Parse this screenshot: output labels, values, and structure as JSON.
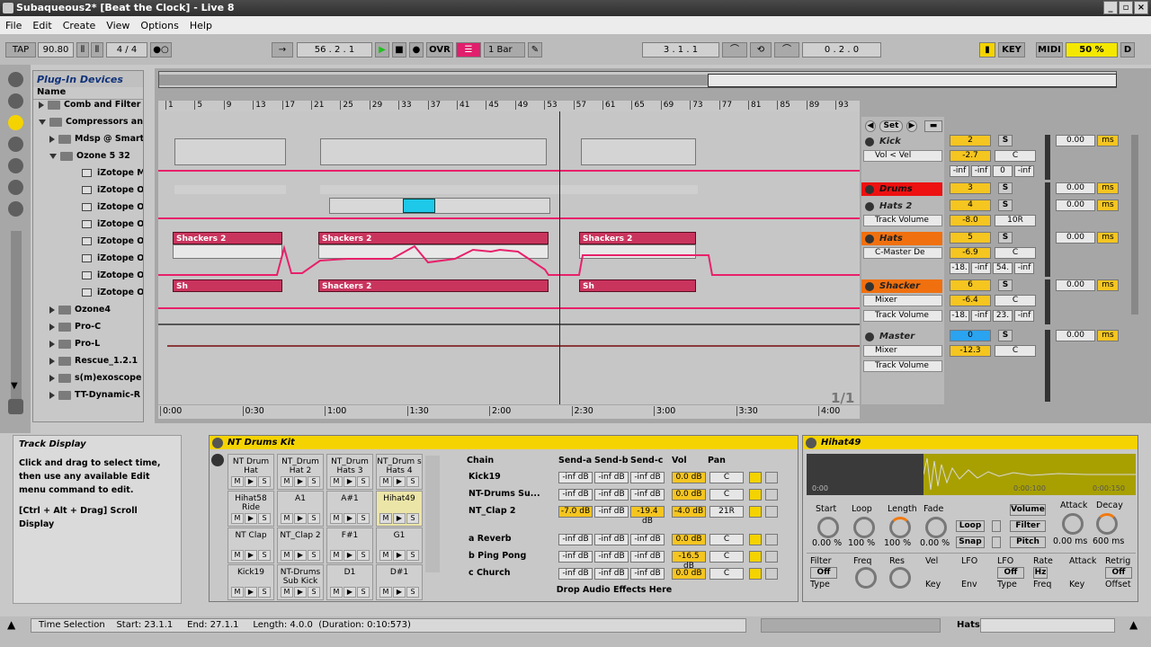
{
  "title_bar": {
    "title": "Subaqueous2*  [Beat the Clock] - Live 8"
  },
  "menu": [
    "File",
    "Edit",
    "Create",
    "View",
    "Options",
    "Help"
  ],
  "transport": {
    "tap": "TAP",
    "tempo": "90.80",
    "signature": "4 / 4",
    "position": "56 . 2 . 1",
    "ovr": "OVR",
    "quantize": "1 Bar",
    "loop_start": "3 . 1 . 1",
    "loop_length": "0 . 2 . 0",
    "key": "KEY",
    "midi": "MIDI",
    "cpu": "50 %",
    "d": "D"
  },
  "browser": {
    "title": "Plug-In Devices",
    "column": "Name",
    "items": [
      {
        "label": "Comb and Filter",
        "type": "folder",
        "level": 1,
        "open": false
      },
      {
        "label": "Compressors and",
        "type": "folder",
        "level": 1,
        "open": true
      },
      {
        "label": "Mdsp @ Smart",
        "type": "folder",
        "level": 2,
        "open": false
      },
      {
        "label": "Ozone 5 32",
        "type": "folder",
        "level": 2,
        "open": true
      },
      {
        "label": "iZotope Me",
        "type": "plugin",
        "level": 3
      },
      {
        "label": "iZotope Oz",
        "type": "plugin",
        "level": 3
      },
      {
        "label": "iZotope Oz",
        "type": "plugin",
        "level": 3
      },
      {
        "label": "iZotope Oz",
        "type": "plugin",
        "level": 3
      },
      {
        "label": "iZotope Oz",
        "type": "plugin",
        "level": 3
      },
      {
        "label": "iZotope Oz",
        "type": "plugin",
        "level": 3
      },
      {
        "label": "iZotope Oz",
        "type": "plugin",
        "level": 3
      },
      {
        "label": "iZotope Oz",
        "type": "plugin",
        "level": 3
      },
      {
        "label": "Ozone4",
        "type": "folder",
        "level": 2,
        "open": false
      },
      {
        "label": "Pro-C",
        "type": "folder",
        "level": 2,
        "open": false
      },
      {
        "label": "Pro-L",
        "type": "folder",
        "level": 2,
        "open": false
      },
      {
        "label": "Rescue_1.2.1",
        "type": "folder",
        "level": 2,
        "open": false
      },
      {
        "label": "s(m)exoscope",
        "type": "folder",
        "level": 2,
        "open": false
      },
      {
        "label": "TT-Dynamic-R",
        "type": "folder",
        "level": 2,
        "open": false
      }
    ]
  },
  "ruler": {
    "bars": [
      "1",
      "5",
      "9",
      "13",
      "17",
      "21",
      "25",
      "29",
      "33",
      "37",
      "41",
      "45",
      "49",
      "53",
      "57",
      "61",
      "65",
      "69",
      "73",
      "77",
      "81",
      "85",
      "89",
      "93"
    ]
  },
  "time_axis": [
    "0:00",
    "0:30",
    "1:00",
    "1:30",
    "2:00",
    "2:30",
    "3:00",
    "3:30",
    "4:00"
  ],
  "clips": {
    "shackers": "Shackers 2",
    "sh": "Sh",
    "page": "1/1"
  },
  "set_button": "Set",
  "tracks": [
    {
      "name": "Kick",
      "device": "Vol < Vel",
      "num": "2",
      "vol": "-2.7",
      "pan": "C",
      "sends": [
        "-inf",
        "-inf",
        "0",
        "-inf"
      ],
      "sendval": "0.00",
      "unit": "ms"
    },
    {
      "name": "Drums",
      "device": "",
      "num": "3",
      "vol": "",
      "pan": "",
      "sendval": "0.00",
      "unit": "ms"
    },
    {
      "name": "Hats 2",
      "device": "Track Volume",
      "num": "4",
      "vol": "-8.0",
      "pan": "10R",
      "sendval": "0.00",
      "unit": "ms"
    },
    {
      "name": "Hats",
      "device": "C-Master De",
      "device2": "",
      "num": "5",
      "vol": "-6.9",
      "pan": "C",
      "sends": [
        "-18.",
        "-inf",
        "54.",
        "-inf"
      ],
      "sendval": "0.00",
      "unit": "ms"
    },
    {
      "name": "Shacker",
      "device": "Mixer",
      "device2": "Track Volume",
      "num": "6",
      "vol": "-6.4",
      "pan": "C",
      "sends": [
        "-18.",
        "-inf",
        "23.",
        "-inf"
      ],
      "sendval": "0.00",
      "unit": "ms"
    },
    {
      "name": "Master",
      "device": "Mixer",
      "device2": "Track Volume",
      "num": "0",
      "vol": "-12.3",
      "pan": "C",
      "sendval": "0.00",
      "unit": "ms"
    }
  ],
  "info": {
    "title": "Track Display",
    "text1": "Click and drag to select time, then use any available Edit menu command to edit.",
    "text2": "[Ctrl + Alt + Drag] Scroll Display"
  },
  "drum_rack": {
    "title": "NT Drums Kit",
    "pads": [
      [
        "NT Drum Hat",
        "NT_Drum Hat 2",
        "NT_Drum Hats 3",
        "NT_Drum s Hats 4"
      ],
      [
        "Hihat58 Ride",
        "A1",
        "A#1",
        "Hihat49"
      ],
      [
        "NT Clap",
        "NT_Clap 2",
        "F#1",
        "G1"
      ],
      [
        "Kick19",
        "NT-Drums Sub Kick",
        "D1",
        "D#1"
      ]
    ],
    "mute": "M",
    "play": "▶",
    "solo": "S",
    "chain_headers": [
      "Chain",
      "Send-a",
      "Send-b",
      "Send-c",
      "Vol",
      "Pan"
    ],
    "chains": [
      {
        "name": "Kick19",
        "a": "-inf dB",
        "b": "-inf dB",
        "c": "-inf dB",
        "vol": "0.0 dB",
        "pan": "C"
      },
      {
        "name": "NT-Drums Su...",
        "a": "-inf dB",
        "b": "-inf dB",
        "c": "-inf dB",
        "vol": "0.0 dB",
        "pan": "C"
      },
      {
        "name": "NT_Clap 2",
        "a": "-7.0 dB",
        "b": "-inf dB",
        "c": "-19.4 dB",
        "vol": "-4.0 dB",
        "pan": "21R"
      }
    ],
    "returns": [
      {
        "name": "a Reverb",
        "a": "-inf dB",
        "b": "-inf dB",
        "c": "-inf dB",
        "vol": "0.0 dB",
        "pan": "C"
      },
      {
        "name": "b Ping Pong",
        "a": "-inf dB",
        "b": "-inf dB",
        "c": "-inf dB",
        "vol": "-16.5 dB",
        "pan": "C"
      },
      {
        "name": "c Church",
        "a": "-inf dB",
        "b": "-inf dB",
        "c": "-inf dB",
        "vol": "0.0 dB",
        "pan": "C"
      }
    ],
    "drop_text": "Drop Audio Effects Here"
  },
  "sampler": {
    "title": "Hihat49",
    "wave_times": [
      "0:00",
      "0:00:100",
      "0:00:150"
    ],
    "knobs": [
      {
        "label": "Start",
        "value": "0.00 %"
      },
      {
        "label": "Loop",
        "value": "100 %"
      },
      {
        "label": "Length",
        "value": "100 %"
      },
      {
        "label": "Fade",
        "value": "0.00 %"
      }
    ],
    "loop": "Loop",
    "snap": "Snap",
    "volume": "Volume",
    "filter": "Filter",
    "pitch": "Pitch",
    "attack": {
      "label": "Attack",
      "value": "0.00 ms"
    },
    "decay": {
      "label": "Decay",
      "value": "600 ms"
    },
    "row2": [
      "Filter",
      "Freq",
      "Res",
      "Vel",
      "LFO",
      "LFO",
      "Rate",
      "Attack",
      "Retrig"
    ],
    "off": "Off",
    "off2": "Off",
    "off3": "Off",
    "hz": "Hz",
    "row3": [
      "Type",
      "Key",
      "Env",
      "Type",
      "Freq",
      "Key",
      "Offset"
    ]
  },
  "status": {
    "text": "Time Selection    Start: 23.1.1     End: 27.1.1     Length: 4.0.0  (Duration: 0:10:573)",
    "track": "Hats"
  }
}
